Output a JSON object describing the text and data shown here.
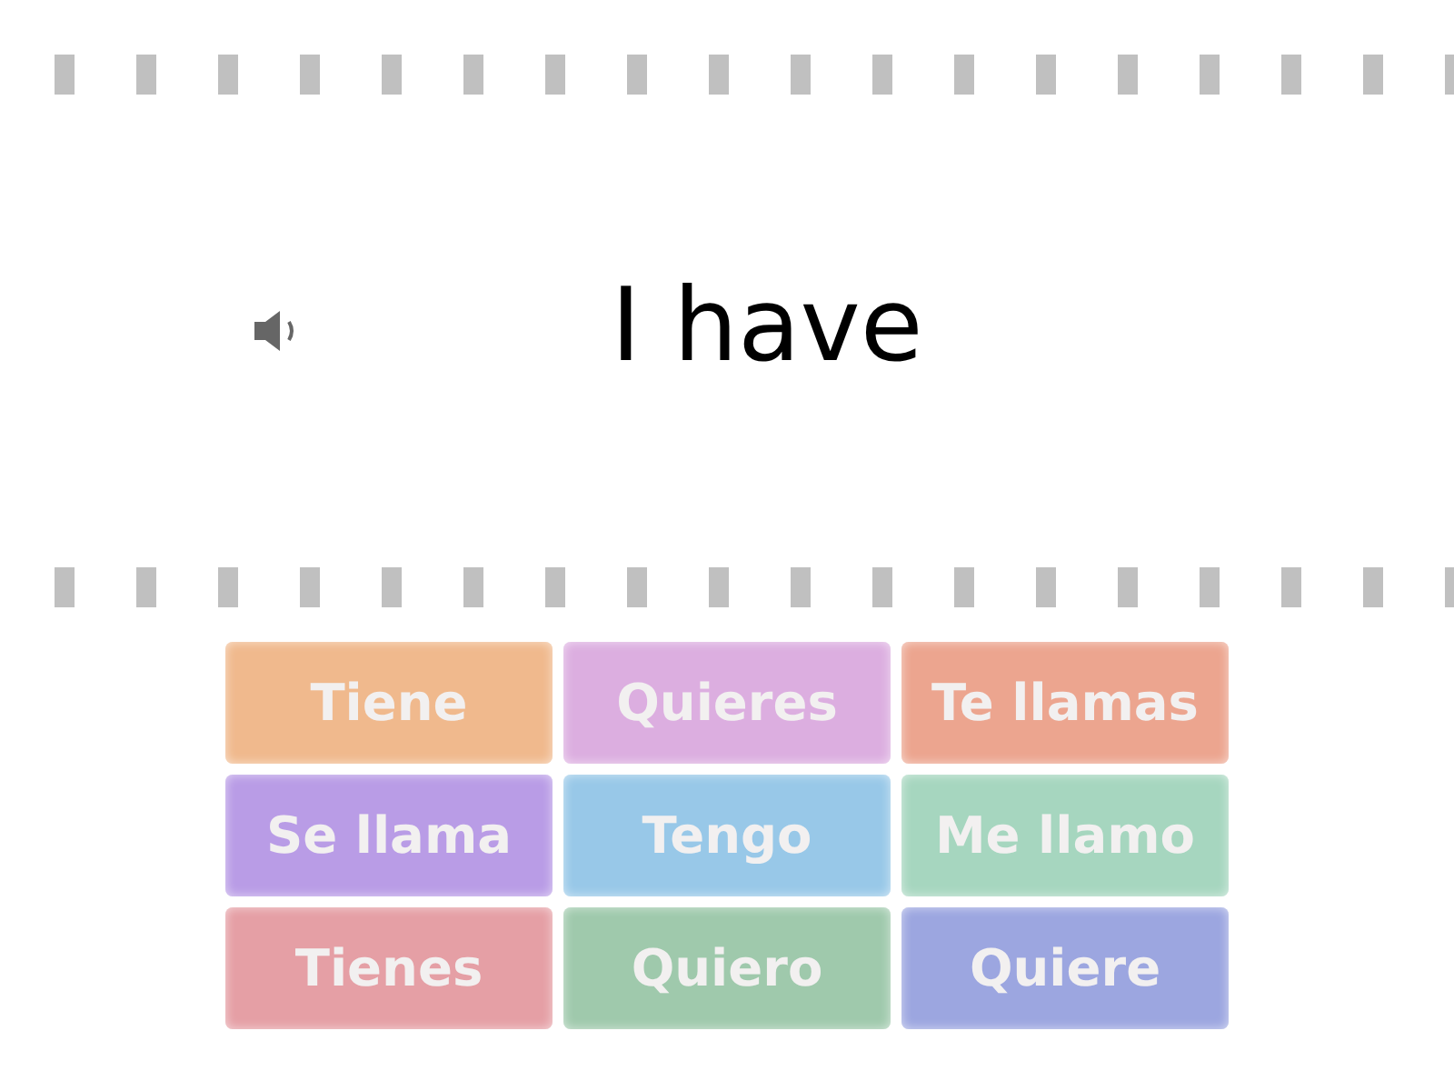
{
  "prompt": {
    "text": "I have"
  },
  "answers": [
    {
      "label": "Tiene",
      "color": "#f0b98d"
    },
    {
      "label": "Quieres",
      "color": "#dcaee0"
    },
    {
      "label": "Te llamas",
      "color": "#eca58f"
    },
    {
      "label": "Se llama",
      "color": "#b99ce6"
    },
    {
      "label": "Tengo",
      "color": "#98c8e8"
    },
    {
      "label": "Me llamo",
      "color": "#a6d6bf"
    },
    {
      "label": "Tienes",
      "color": "#e59fa5"
    },
    {
      "label": "Quiero",
      "color": "#9fc9ac"
    },
    {
      "label": "Quiere",
      "color": "#9ca6e0"
    }
  ]
}
